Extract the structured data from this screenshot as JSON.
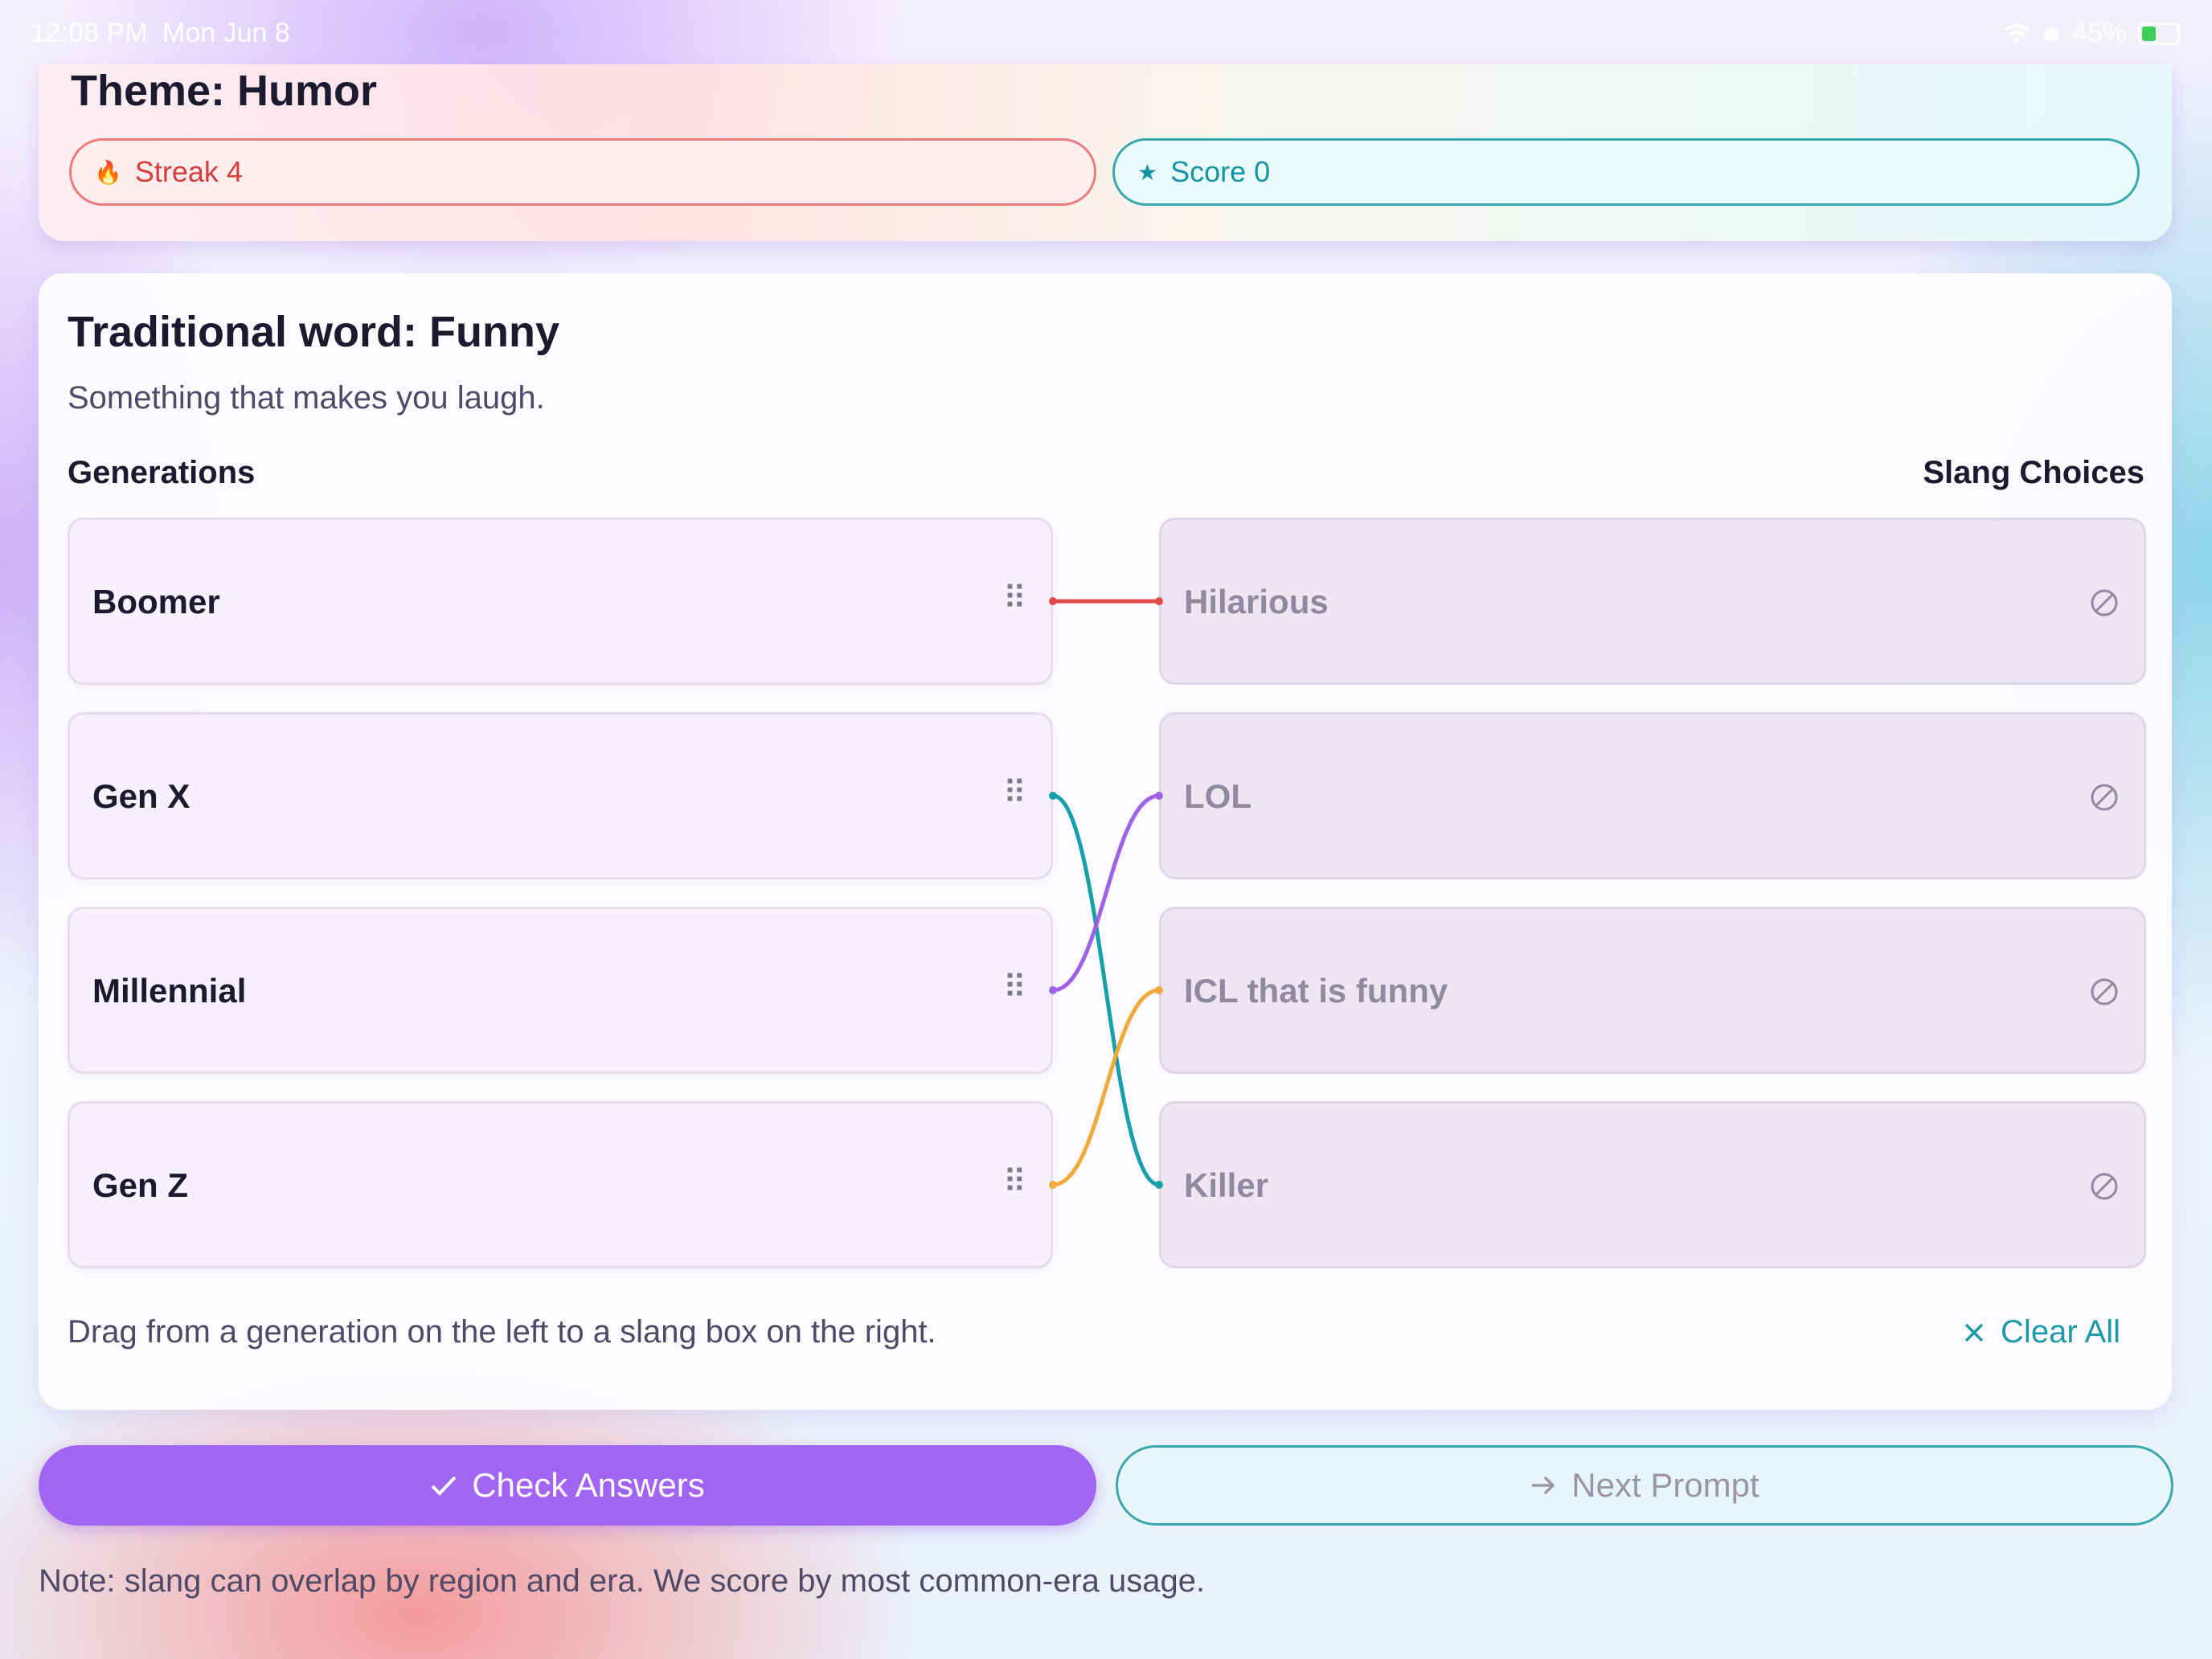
{
  "status_bar": {
    "time": "12:08 PM",
    "date": "Mon Jun 8",
    "battery": "45%"
  },
  "header": {
    "theme_title": "Theme: Humor",
    "streak_label": "Streak 4",
    "score_label": "Score 0"
  },
  "prompt": {
    "title": "Traditional word: Funny",
    "definition": "Something that makes you laugh."
  },
  "columns": {
    "left_heading": "Generations",
    "right_heading": "Slang Choices"
  },
  "generations": [
    {
      "label": "Boomer"
    },
    {
      "label": "Gen X"
    },
    {
      "label": "Millennial"
    },
    {
      "label": "Gen Z"
    }
  ],
  "slang_choices": [
    {
      "label": "Hilarious"
    },
    {
      "label": "LOL"
    },
    {
      "label": "ICL that is funny"
    },
    {
      "label": "Killer"
    }
  ],
  "links": [
    {
      "from": "Boomer",
      "to": "Hilarious",
      "color": "#e14b4b"
    },
    {
      "from": "Gen X",
      "to": "Killer",
      "color": "#16a0ae"
    },
    {
      "from": "Millennial",
      "to": "LOL",
      "color": "#9d62e6"
    },
    {
      "from": "Gen Z",
      "to": "ICL that is funny",
      "color": "#f0ab3c"
    }
  ],
  "hint_text": "Drag from a generation on the left to a slang box on the right.",
  "clear_all_label": "Clear All",
  "actions": {
    "check_label": "Check Answers",
    "next_label": "Next Prompt"
  },
  "note": "Note: slang can overlap by region and era. We score by most common-era usage.",
  "colors": {
    "accent_purple": "#a264f2",
    "accent_teal": "#1d9aa6",
    "streak_red": "#d83c3c"
  }
}
